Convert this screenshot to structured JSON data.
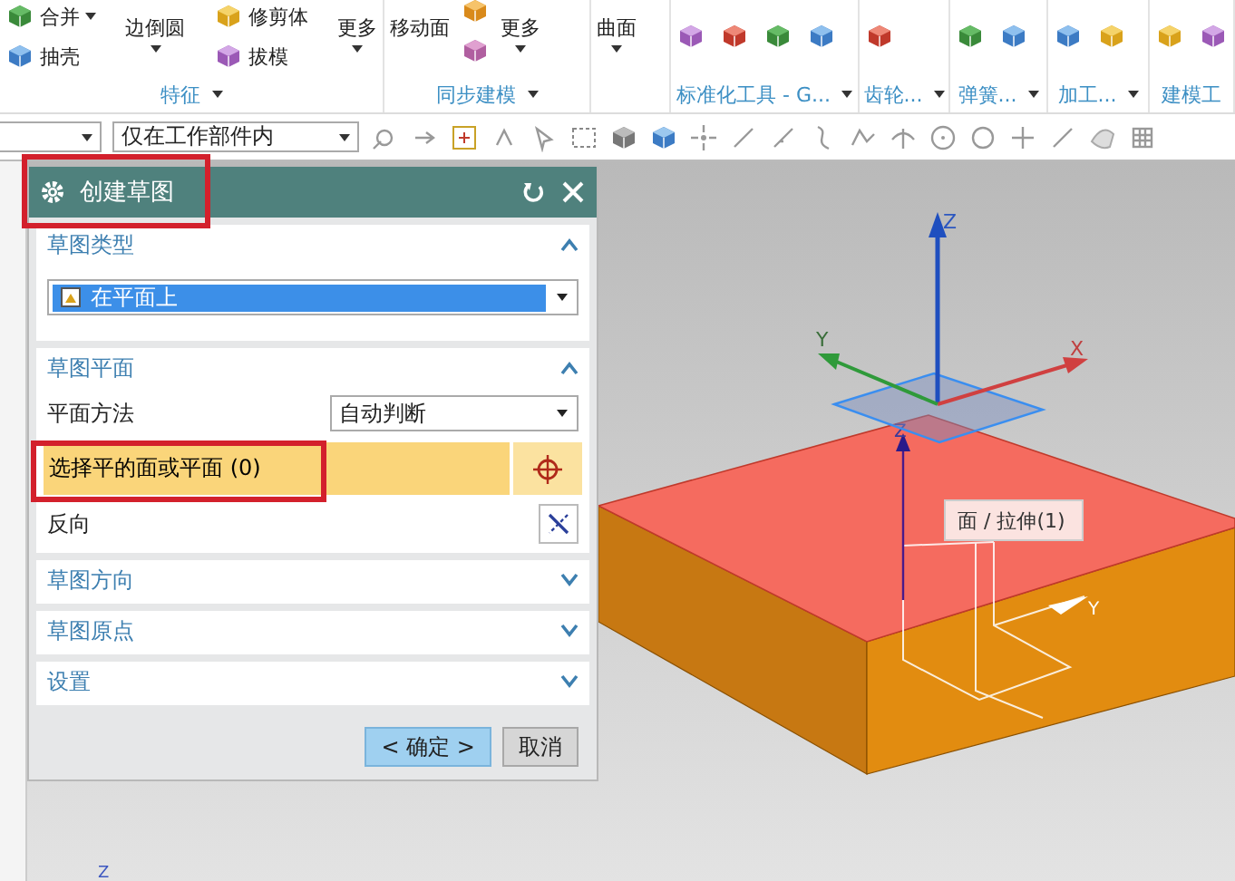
{
  "ribbon": {
    "groups": [
      {
        "label": "特征",
        "menu": true,
        "items": [
          {
            "kind": "stack",
            "entries": [
              {
                "label": "合并",
                "menu": true
              },
              {
                "label": "抽壳",
                "menu": false
              }
            ]
          },
          {
            "kind": "large",
            "label": "边倒圆",
            "menu": true
          },
          {
            "kind": "stack",
            "entries": [
              {
                "label": "修剪体",
                "menu": false
              },
              {
                "label": "拔模",
                "menu": false
              }
            ]
          },
          {
            "kind": "large",
            "label": "更多",
            "menu": true
          }
        ]
      },
      {
        "label": "同步建模",
        "menu": true,
        "items": [
          {
            "kind": "large",
            "label": "移动面",
            "menu": false
          },
          {
            "kind": "icon_column"
          },
          {
            "kind": "large",
            "label": "更多",
            "menu": true
          }
        ]
      },
      {
        "menu": false,
        "items": [
          {
            "kind": "large",
            "label": "曲面",
            "menu": true
          }
        ]
      },
      {
        "label": "标准化工具 - G...",
        "menu": true,
        "items": [
          {
            "kind": "icon_row"
          }
        ]
      },
      {
        "label": "齿轮...",
        "menu": true,
        "items": [
          {
            "kind": "icon_row"
          }
        ]
      },
      {
        "label": "弹簧...",
        "menu": true,
        "items": [
          {
            "kind": "icon_row"
          }
        ]
      },
      {
        "label": "加工...",
        "menu": true,
        "items": [
          {
            "kind": "icon_row"
          }
        ]
      },
      {
        "label": "建模工",
        "menu": false,
        "items": [
          {
            "kind": "icon_row"
          }
        ]
      }
    ]
  },
  "toolbar": {
    "scope_filter": "仅在工作部件内"
  },
  "dialog": {
    "title": "创建草图",
    "highlighted": true,
    "sections": [
      {
        "kind": "type",
        "title": "草图类型",
        "expanded": true,
        "value": "在平面上"
      },
      {
        "kind": "plane",
        "title": "草图平面",
        "expanded": true,
        "method_label": "平面方法",
        "method_value": "自动判断",
        "selection": {
          "label": "选择平的面或平面 (0)",
          "active": true,
          "highlighted": true
        },
        "reverse_label": "反向"
      },
      {
        "title": "草图方向",
        "expanded": false
      },
      {
        "title": "草图原点",
        "expanded": false
      },
      {
        "title": "设置",
        "expanded": false
      }
    ],
    "buttons": [
      {
        "label": "< 确定 >",
        "primary": true
      },
      {
        "label": "取消",
        "primary": false
      }
    ]
  },
  "viewport": {
    "csys_labels": {
      "z": "Z",
      "y": "Y",
      "x": "X"
    },
    "face_labels": {
      "z": "Z",
      "y": "Y"
    },
    "tooltip": "面 / 拉伸(1)",
    "corner_label": "Z"
  }
}
